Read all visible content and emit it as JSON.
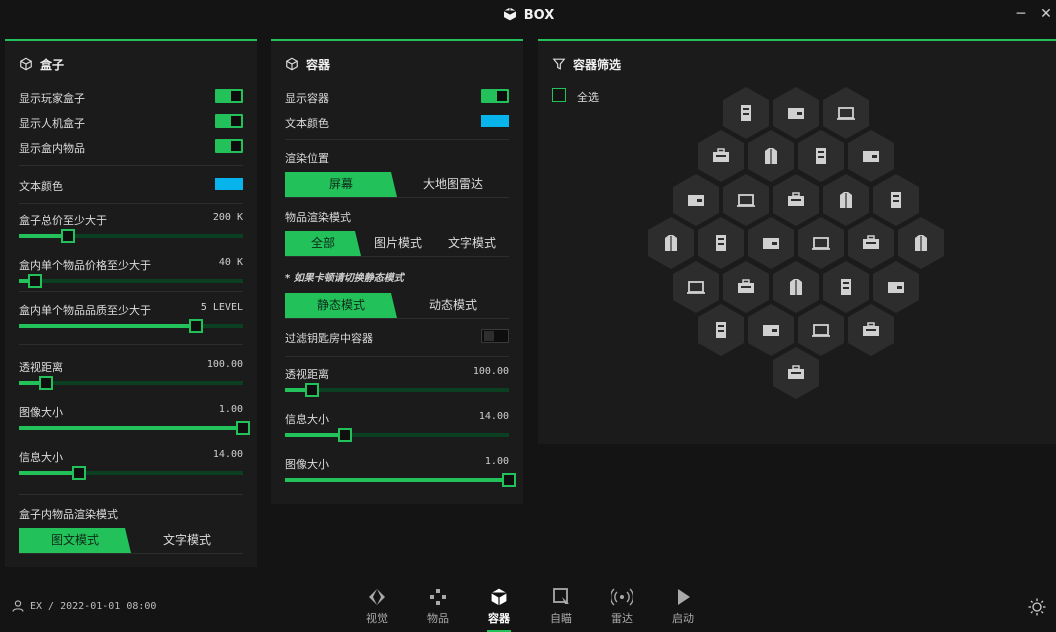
{
  "window": {
    "title": "BOX",
    "minimize_glyph": "─",
    "close_glyph": "✕"
  },
  "colors": {
    "accent": "#22c15a",
    "panel": "#1b1b1b",
    "hex": "#2d2d2d",
    "text_color_swatch": "#08b4ec"
  },
  "box_panel": {
    "title": "盒子",
    "toggles": [
      {
        "label": "显示玩家盒子",
        "on": true
      },
      {
        "label": "显示人机盒子",
        "on": true
      },
      {
        "label": "显示盒内物品",
        "on": true
      }
    ],
    "text_color_label": "文本颜色",
    "sliders": [
      {
        "label": "盒子总价至少大于",
        "value": "200 K",
        "level": 0.22
      },
      {
        "label": "盒内单个物品价格至少大于",
        "value": "40 K",
        "level": 0.07
      },
      {
        "label": "盒内单个物品品质至少大于",
        "value": "5 LEVEL",
        "level": 0.79
      },
      {
        "label": "透视距离",
        "value": "100.00",
        "level": 0.12
      },
      {
        "label": "图像大小",
        "value": "1.00",
        "level": 1.0
      },
      {
        "label": "信息大小",
        "value": "14.00",
        "level": 0.27
      }
    ],
    "render_mode_label": "盒子内物品渲染模式",
    "render_mode_options": [
      "图文模式",
      "文字模式"
    ],
    "render_mode_selected": 0
  },
  "container_panel": {
    "title": "容器",
    "show_label": "显示容器",
    "show_on": true,
    "text_color_label": "文本颜色",
    "render_pos_label": "渲染位置",
    "render_pos_options": [
      "屏幕",
      "大地图雷达"
    ],
    "item_mode_label": "物品渲染模式",
    "item_mode_options": [
      "全部",
      "图片模式",
      "文字模式"
    ],
    "note": "* 如果卡顿请切换静态模式",
    "motion_options": [
      "静态模式",
      "动态模式"
    ],
    "filter_key_label": "过滤钥匙房中容器",
    "filter_key_on": false,
    "sliders": [
      {
        "label": "透视距离",
        "value": "100.00",
        "level": 0.12
      },
      {
        "label": "信息大小",
        "value": "14.00",
        "level": 0.27
      },
      {
        "label": "图像大小",
        "value": "1.00",
        "level": 1.0
      }
    ]
  },
  "filter_panel": {
    "title": "容器筛选",
    "select_all_label": "全选",
    "hex_rows": [
      [
        "cabinet-icon",
        "wallet-icon",
        "server-icon"
      ],
      [
        "laptop-icon",
        "locker-icon",
        "bag-icon",
        "safe-icon"
      ],
      [
        "toolbox-icon",
        "fridge-icon",
        "medkit-icon",
        "jacket-icon",
        "coat-icon"
      ],
      [
        "medbag-icon",
        "cash-stack-icon",
        "shopping-bag-icon",
        "crate-icon",
        "phone-icon",
        "chest-icon"
      ],
      [
        "drawer-icon",
        "briefcase-icon",
        "package-icon",
        "box-x-icon",
        "recycle-bin-icon"
      ],
      [
        "mixer-truck-icon",
        "cash-pile-icon",
        "hat-icon",
        "target-icon"
      ],
      [
        "suitcase-icon"
      ]
    ]
  },
  "footer": {
    "user": "EX / 2022-01-01 08:00",
    "nav": [
      {
        "label": "视觉",
        "icon": "eye-icon"
      },
      {
        "label": "物品",
        "icon": "items-icon"
      },
      {
        "label": "容器",
        "icon": "cube-icon"
      },
      {
        "label": "自瞄",
        "icon": "aim-icon"
      },
      {
        "label": "雷达",
        "icon": "radar-icon"
      },
      {
        "label": "启动",
        "icon": "play-icon"
      }
    ],
    "active": 2
  }
}
